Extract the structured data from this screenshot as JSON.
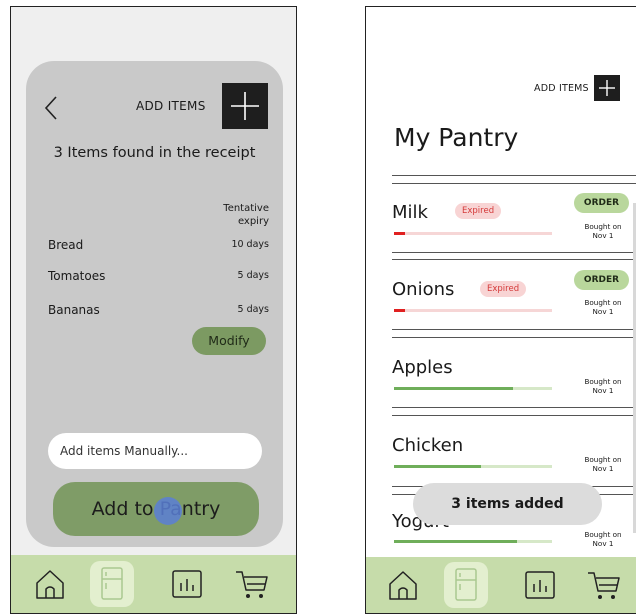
{
  "left": {
    "header_label": "ADD ITEMS",
    "found_text": "3 Items found in the receipt",
    "expiry_header": [
      "Tentative",
      "expiry"
    ],
    "items": [
      {
        "name": "Bread",
        "days": "10 days"
      },
      {
        "name": "Tomatoes",
        "days": "5 days"
      },
      {
        "name": "Bananas",
        "days": "5 days"
      }
    ],
    "modify_label": "Modify",
    "manual_placeholder": "Add items Manually...",
    "add_button_label": "Add to Pantry"
  },
  "right": {
    "header_label": "ADD ITEMS",
    "title": "My Pantry",
    "items": [
      {
        "name": "Milk",
        "expired": "Expired",
        "order": "ORDER",
        "bought": [
          "Bought on",
          "Nov 1"
        ],
        "level": 0.07,
        "status": "expired"
      },
      {
        "name": "Onions",
        "expired": "Expired",
        "order": "ORDER",
        "bought": [
          "Bought on",
          "Nov 1"
        ],
        "level": 0.07,
        "status": "expired"
      },
      {
        "name": "Apples",
        "bought": [
          "Bought on",
          "Nov 1"
        ],
        "level": 0.75,
        "status": "ok"
      },
      {
        "name": "Chicken",
        "bought": [
          "Bought on",
          "Nov 1"
        ],
        "level": 0.55,
        "status": "ok"
      },
      {
        "name": "Yogurt",
        "bought": [
          "Bought on",
          "Nov 1"
        ],
        "level": 0.78,
        "status": "ok"
      }
    ],
    "toast": "3 items added"
  },
  "nav": {
    "items": [
      "home-icon",
      "fridge-icon",
      "chart-icon",
      "cart-icon"
    ],
    "active": "fridge-icon"
  },
  "colors": {
    "accent_green": "#7f9c67",
    "nav_bg": "#c6dcaa",
    "expired_red": "#d43a3a",
    "bar_red": "#e02020",
    "bar_green": "#6fae5a"
  }
}
